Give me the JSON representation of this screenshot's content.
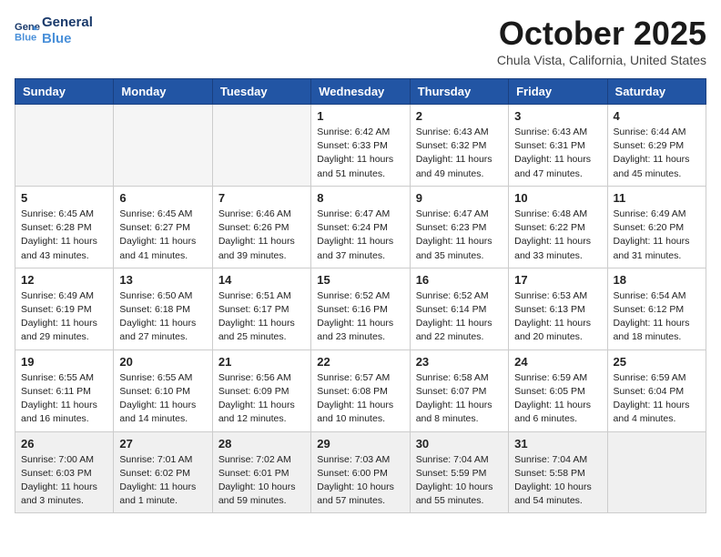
{
  "header": {
    "logo_line1": "General",
    "logo_line2": "Blue",
    "month": "October 2025",
    "location": "Chula Vista, California, United States"
  },
  "days_of_week": [
    "Sunday",
    "Monday",
    "Tuesday",
    "Wednesday",
    "Thursday",
    "Friday",
    "Saturday"
  ],
  "weeks": [
    [
      {
        "day": "",
        "info": ""
      },
      {
        "day": "",
        "info": ""
      },
      {
        "day": "",
        "info": ""
      },
      {
        "day": "1",
        "info": "Sunrise: 6:42 AM\nSunset: 6:33 PM\nDaylight: 11 hours\nand 51 minutes."
      },
      {
        "day": "2",
        "info": "Sunrise: 6:43 AM\nSunset: 6:32 PM\nDaylight: 11 hours\nand 49 minutes."
      },
      {
        "day": "3",
        "info": "Sunrise: 6:43 AM\nSunset: 6:31 PM\nDaylight: 11 hours\nand 47 minutes."
      },
      {
        "day": "4",
        "info": "Sunrise: 6:44 AM\nSunset: 6:29 PM\nDaylight: 11 hours\nand 45 minutes."
      }
    ],
    [
      {
        "day": "5",
        "info": "Sunrise: 6:45 AM\nSunset: 6:28 PM\nDaylight: 11 hours\nand 43 minutes."
      },
      {
        "day": "6",
        "info": "Sunrise: 6:45 AM\nSunset: 6:27 PM\nDaylight: 11 hours\nand 41 minutes."
      },
      {
        "day": "7",
        "info": "Sunrise: 6:46 AM\nSunset: 6:26 PM\nDaylight: 11 hours\nand 39 minutes."
      },
      {
        "day": "8",
        "info": "Sunrise: 6:47 AM\nSunset: 6:24 PM\nDaylight: 11 hours\nand 37 minutes."
      },
      {
        "day": "9",
        "info": "Sunrise: 6:47 AM\nSunset: 6:23 PM\nDaylight: 11 hours\nand 35 minutes."
      },
      {
        "day": "10",
        "info": "Sunrise: 6:48 AM\nSunset: 6:22 PM\nDaylight: 11 hours\nand 33 minutes."
      },
      {
        "day": "11",
        "info": "Sunrise: 6:49 AM\nSunset: 6:20 PM\nDaylight: 11 hours\nand 31 minutes."
      }
    ],
    [
      {
        "day": "12",
        "info": "Sunrise: 6:49 AM\nSunset: 6:19 PM\nDaylight: 11 hours\nand 29 minutes."
      },
      {
        "day": "13",
        "info": "Sunrise: 6:50 AM\nSunset: 6:18 PM\nDaylight: 11 hours\nand 27 minutes."
      },
      {
        "day": "14",
        "info": "Sunrise: 6:51 AM\nSunset: 6:17 PM\nDaylight: 11 hours\nand 25 minutes."
      },
      {
        "day": "15",
        "info": "Sunrise: 6:52 AM\nSunset: 6:16 PM\nDaylight: 11 hours\nand 23 minutes."
      },
      {
        "day": "16",
        "info": "Sunrise: 6:52 AM\nSunset: 6:14 PM\nDaylight: 11 hours\nand 22 minutes."
      },
      {
        "day": "17",
        "info": "Sunrise: 6:53 AM\nSunset: 6:13 PM\nDaylight: 11 hours\nand 20 minutes."
      },
      {
        "day": "18",
        "info": "Sunrise: 6:54 AM\nSunset: 6:12 PM\nDaylight: 11 hours\nand 18 minutes."
      }
    ],
    [
      {
        "day": "19",
        "info": "Sunrise: 6:55 AM\nSunset: 6:11 PM\nDaylight: 11 hours\nand 16 minutes."
      },
      {
        "day": "20",
        "info": "Sunrise: 6:55 AM\nSunset: 6:10 PM\nDaylight: 11 hours\nand 14 minutes."
      },
      {
        "day": "21",
        "info": "Sunrise: 6:56 AM\nSunset: 6:09 PM\nDaylight: 11 hours\nand 12 minutes."
      },
      {
        "day": "22",
        "info": "Sunrise: 6:57 AM\nSunset: 6:08 PM\nDaylight: 11 hours\nand 10 minutes."
      },
      {
        "day": "23",
        "info": "Sunrise: 6:58 AM\nSunset: 6:07 PM\nDaylight: 11 hours\nand 8 minutes."
      },
      {
        "day": "24",
        "info": "Sunrise: 6:59 AM\nSunset: 6:05 PM\nDaylight: 11 hours\nand 6 minutes."
      },
      {
        "day": "25",
        "info": "Sunrise: 6:59 AM\nSunset: 6:04 PM\nDaylight: 11 hours\nand 4 minutes."
      }
    ],
    [
      {
        "day": "26",
        "info": "Sunrise: 7:00 AM\nSunset: 6:03 PM\nDaylight: 11 hours\nand 3 minutes."
      },
      {
        "day": "27",
        "info": "Sunrise: 7:01 AM\nSunset: 6:02 PM\nDaylight: 11 hours\nand 1 minute."
      },
      {
        "day": "28",
        "info": "Sunrise: 7:02 AM\nSunset: 6:01 PM\nDaylight: 10 hours\nand 59 minutes."
      },
      {
        "day": "29",
        "info": "Sunrise: 7:03 AM\nSunset: 6:00 PM\nDaylight: 10 hours\nand 57 minutes."
      },
      {
        "day": "30",
        "info": "Sunrise: 7:04 AM\nSunset: 5:59 PM\nDaylight: 10 hours\nand 55 minutes."
      },
      {
        "day": "31",
        "info": "Sunrise: 7:04 AM\nSunset: 5:58 PM\nDaylight: 10 hours\nand 54 minutes."
      },
      {
        "day": "",
        "info": ""
      }
    ]
  ]
}
